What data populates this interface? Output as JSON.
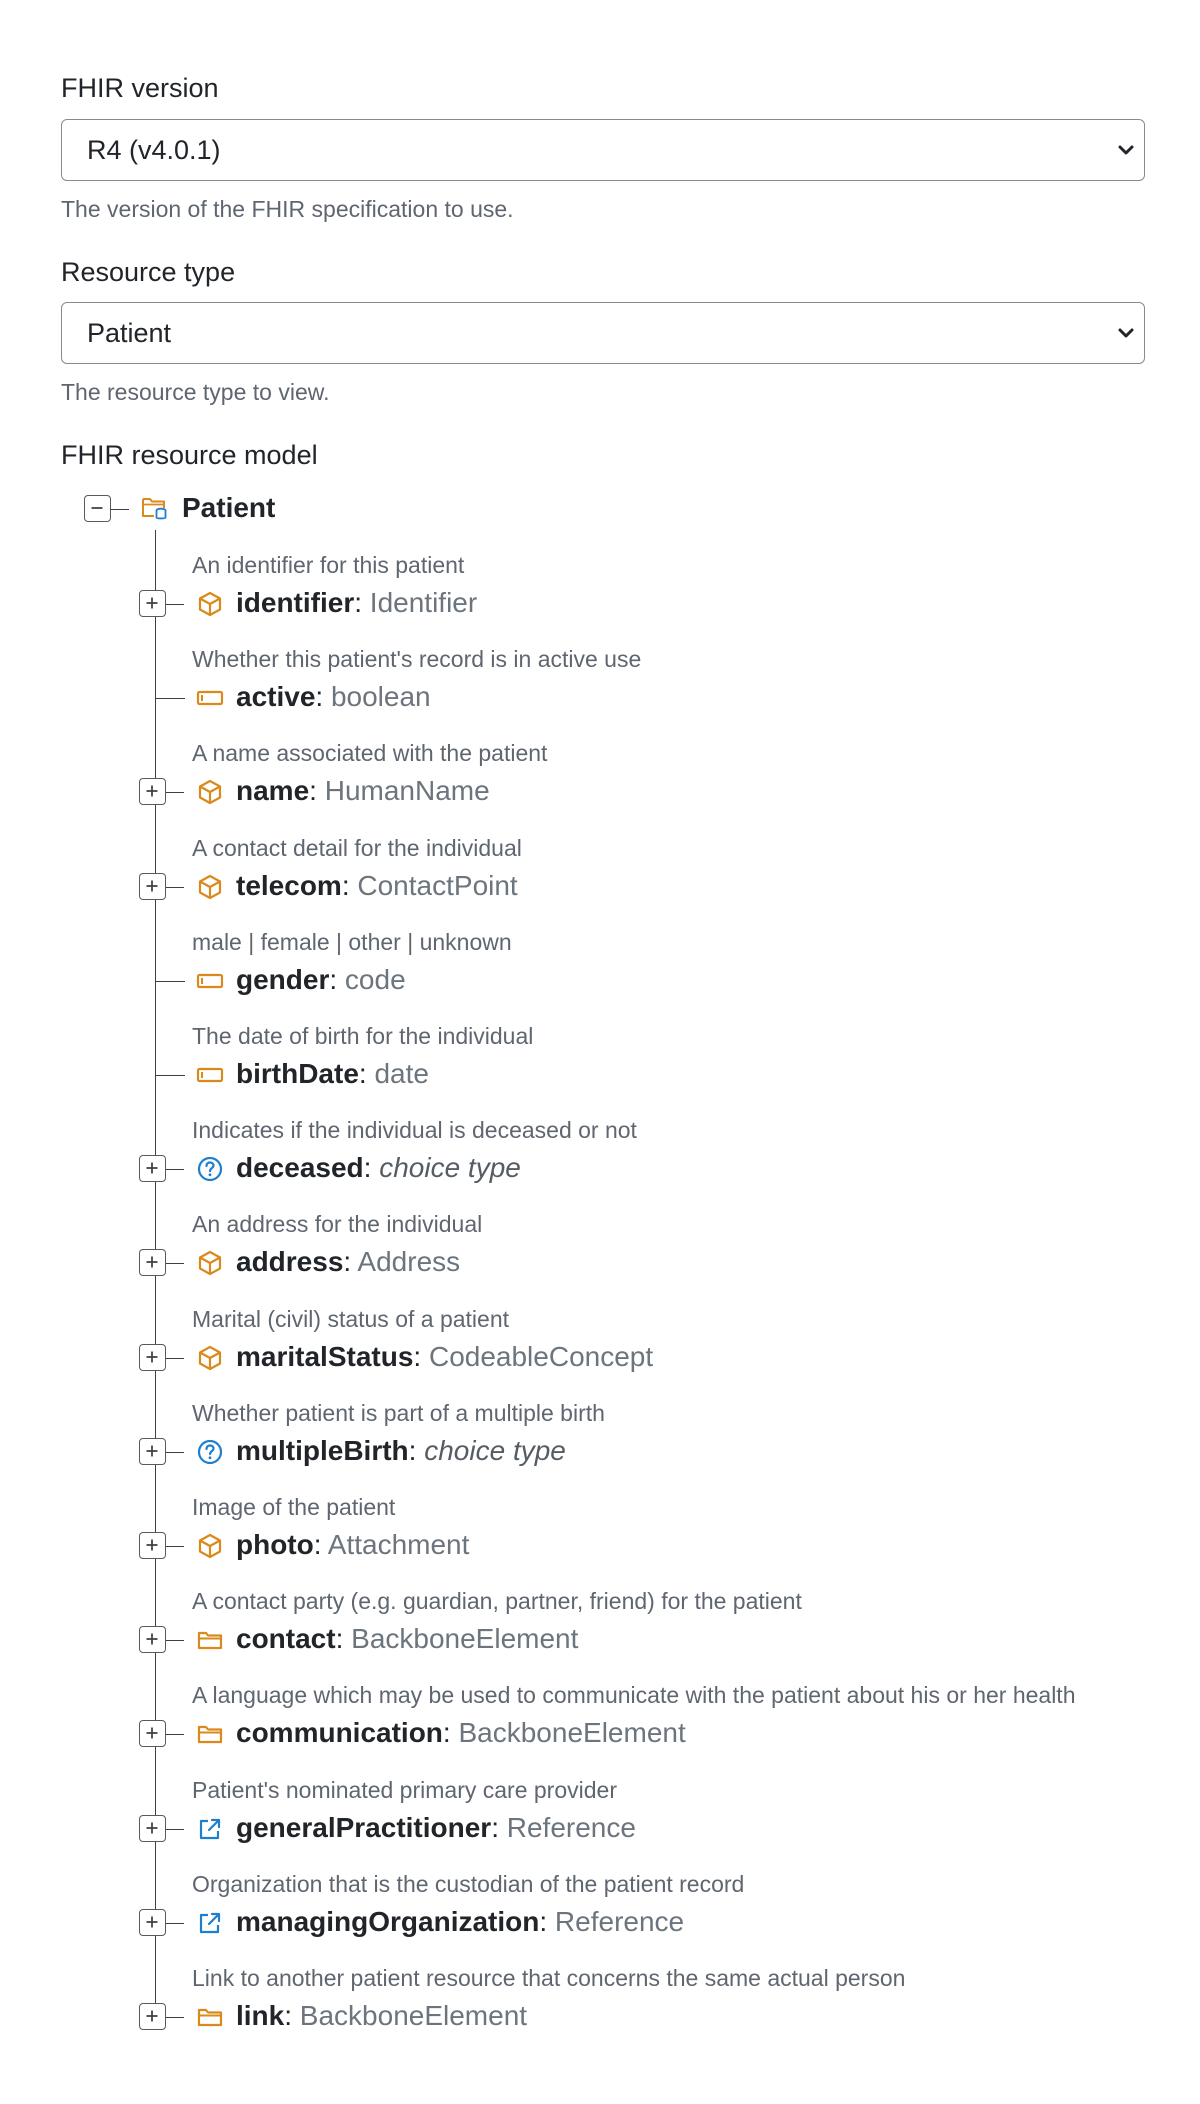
{
  "fhir_version": {
    "label": "FHIR version",
    "selected": "R4 (v4.0.1)",
    "help": "The version of the FHIR specification to use."
  },
  "resource_type": {
    "label": "Resource type",
    "selected": "Patient",
    "help": "The resource type to view."
  },
  "model": {
    "label": "FHIR resource model",
    "root": {
      "name": "Patient",
      "icon": "resource-folder-icon",
      "expanded": true
    },
    "colors": {
      "orange": "#d98a1a",
      "blue": "#1f7fcf",
      "line": "#3f3f3f"
    },
    "elements": [
      {
        "description": "An identifier for this patient",
        "name": "identifier",
        "type": "Identifier",
        "icon": "cube-icon",
        "expandable": true,
        "choice": false
      },
      {
        "description": "Whether this patient's record is in active use",
        "name": "active",
        "type": "boolean",
        "icon": "primitive-icon",
        "expandable": false,
        "choice": false
      },
      {
        "description": "A name associated with the patient",
        "name": "name",
        "type": "HumanName",
        "icon": "cube-icon",
        "expandable": true,
        "choice": false
      },
      {
        "description": "A contact detail for the individual",
        "name": "telecom",
        "type": "ContactPoint",
        "icon": "cube-icon",
        "expandable": true,
        "choice": false
      },
      {
        "description": "male | female | other | unknown",
        "name": "gender",
        "type": "code",
        "icon": "primitive-icon",
        "expandable": false,
        "choice": false
      },
      {
        "description": "The date of birth for the individual",
        "name": "birthDate",
        "type": "date",
        "icon": "primitive-icon",
        "expandable": false,
        "choice": false
      },
      {
        "description": "Indicates if the individual is deceased or not",
        "name": "deceased",
        "type": "choice type",
        "icon": "question-icon",
        "expandable": true,
        "choice": true
      },
      {
        "description": "An address for the individual",
        "name": "address",
        "type": "Address",
        "icon": "cube-icon",
        "expandable": true,
        "choice": false
      },
      {
        "description": "Marital (civil) status of a patient",
        "name": "maritalStatus",
        "type": "CodeableConcept",
        "icon": "cube-icon",
        "expandable": true,
        "choice": false
      },
      {
        "description": "Whether patient is part of a multiple birth",
        "name": "multipleBirth",
        "type": "choice type",
        "icon": "question-icon",
        "expandable": true,
        "choice": true
      },
      {
        "description": "Image of the patient",
        "name": "photo",
        "type": "Attachment",
        "icon": "cube-icon",
        "expandable": true,
        "choice": false
      },
      {
        "description": "A contact party (e.g. guardian, partner, friend) for the patient",
        "name": "contact",
        "type": "BackboneElement",
        "icon": "folder-icon",
        "expandable": true,
        "choice": false
      },
      {
        "description": "A language which may be used to communicate with the patient about his or her health",
        "name": "communication",
        "type": "BackboneElement",
        "icon": "folder-icon",
        "expandable": true,
        "choice": false
      },
      {
        "description": "Patient's nominated primary care provider",
        "name": "generalPractitioner",
        "type": "Reference",
        "icon": "external-link-icon",
        "expandable": true,
        "choice": false
      },
      {
        "description": "Organization that is the custodian of the patient record",
        "name": "managingOrganization",
        "type": "Reference",
        "icon": "external-link-icon",
        "expandable": true,
        "choice": false
      },
      {
        "description": "Link to another patient resource that concerns the same actual person",
        "name": "link",
        "type": "BackboneElement",
        "icon": "folder-icon",
        "expandable": true,
        "choice": false
      }
    ]
  }
}
